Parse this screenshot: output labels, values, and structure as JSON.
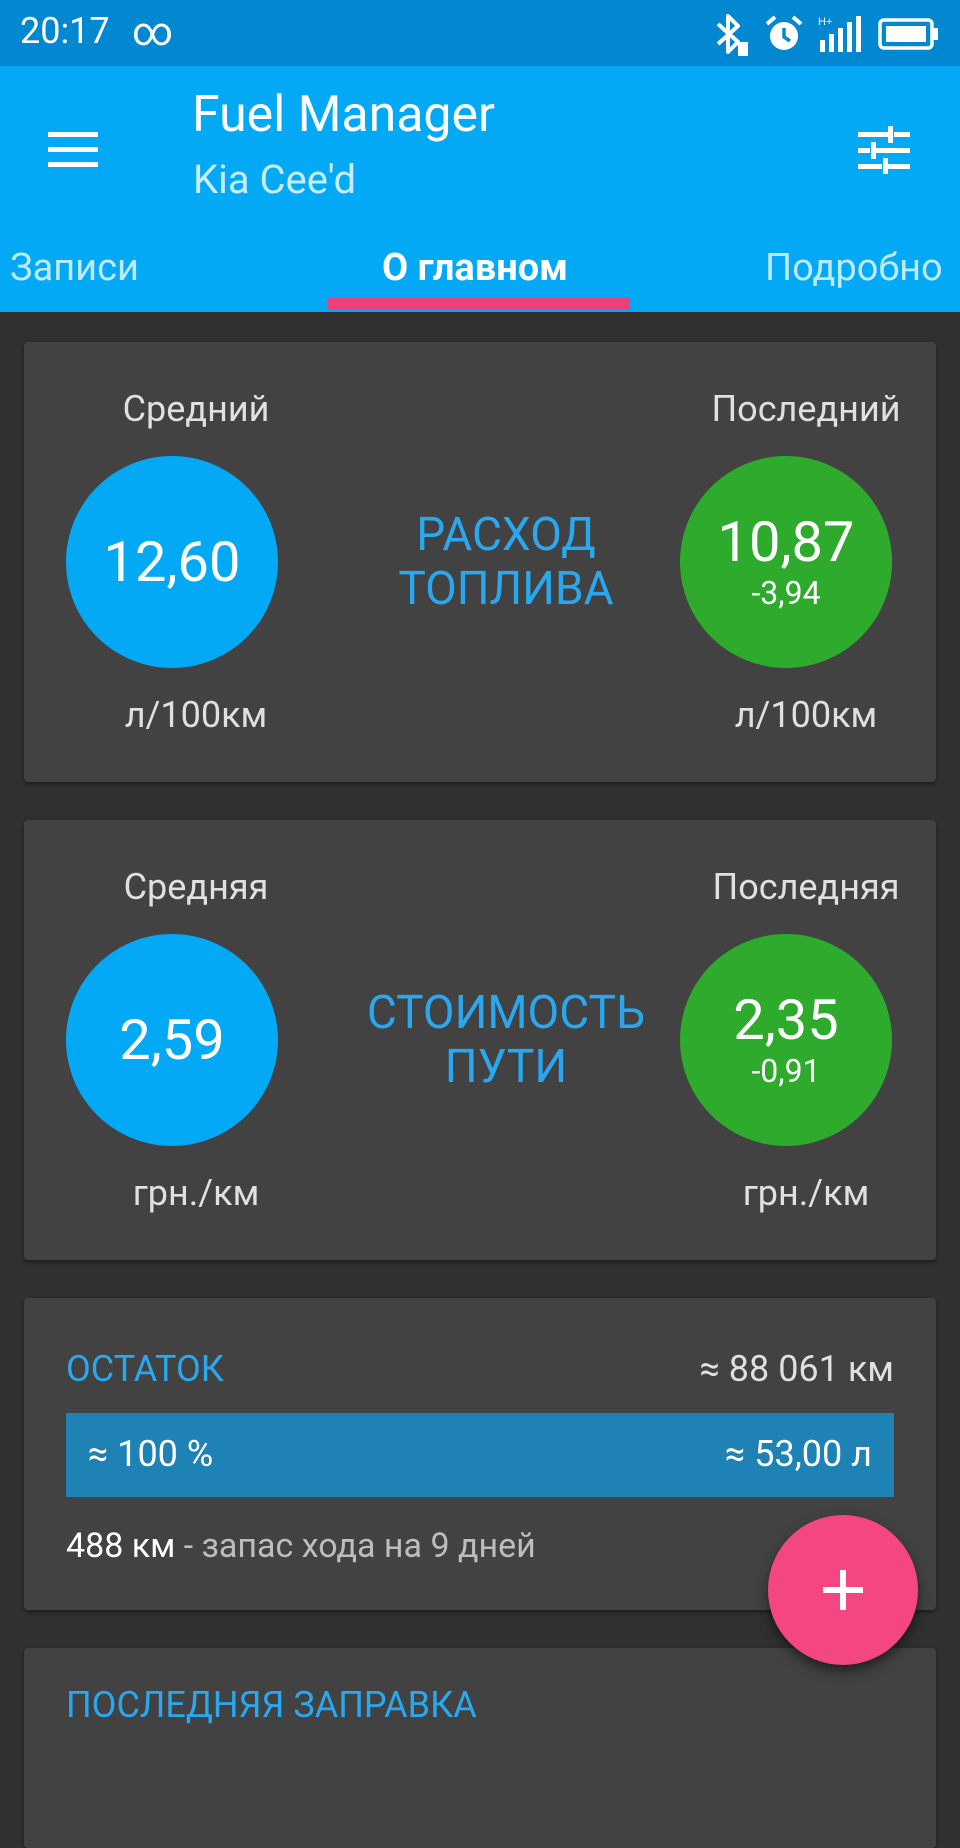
{
  "status_bar": {
    "time": "20:17",
    "infinity": "∞",
    "icons": [
      "bluetooth-icon",
      "alarm-icon",
      "signal-icon",
      "battery-icon"
    ]
  },
  "app_bar": {
    "title": "Fuel Manager",
    "subtitle": "Kia Cee'd",
    "menu_icon": "hamburger-menu-icon",
    "filter_icon": "tune-icon"
  },
  "tabs": [
    {
      "label": "Записи",
      "active": false
    },
    {
      "label": "О главном",
      "active": true
    },
    {
      "label": "Подробно",
      "active": false
    }
  ],
  "fuel_consumption": {
    "title_line1": "РАСХОД",
    "title_line2": "ТОПЛИВА",
    "average_label": "Средний",
    "average_value": "12,60",
    "average_unit": "л/100км",
    "last_label": "Последний",
    "last_value": "10,87",
    "last_diff": "-3,94",
    "last_unit": "л/100км"
  },
  "trip_cost": {
    "title_line1": "СТОИМОСТЬ",
    "title_line2": "ПУТИ",
    "average_label": "Средняя",
    "average_value": "2,59",
    "average_unit": "грн./км",
    "last_label": "Последняя",
    "last_value": "2,35",
    "last_diff": "-0,91",
    "last_unit": "грн./км"
  },
  "remaining": {
    "title": "ОСТАТОК",
    "odometer": "≈ 88 061 км",
    "percent": "≈ 100 %",
    "liters": "≈ 53,00 л",
    "range_km": "488 км",
    "range_text": " - запас хода на 9 дней"
  },
  "last_refuel": {
    "title": "ПОСЛЕДНЯЯ ЗАПРАВКА"
  },
  "fab": {
    "icon": "plus-icon"
  },
  "colors": {
    "primary": "#03a9f4",
    "primary_dark": "#0288d1",
    "accent": "#ec407a",
    "green": "#2eaa2d",
    "card": "#424242",
    "background": "#303030"
  }
}
